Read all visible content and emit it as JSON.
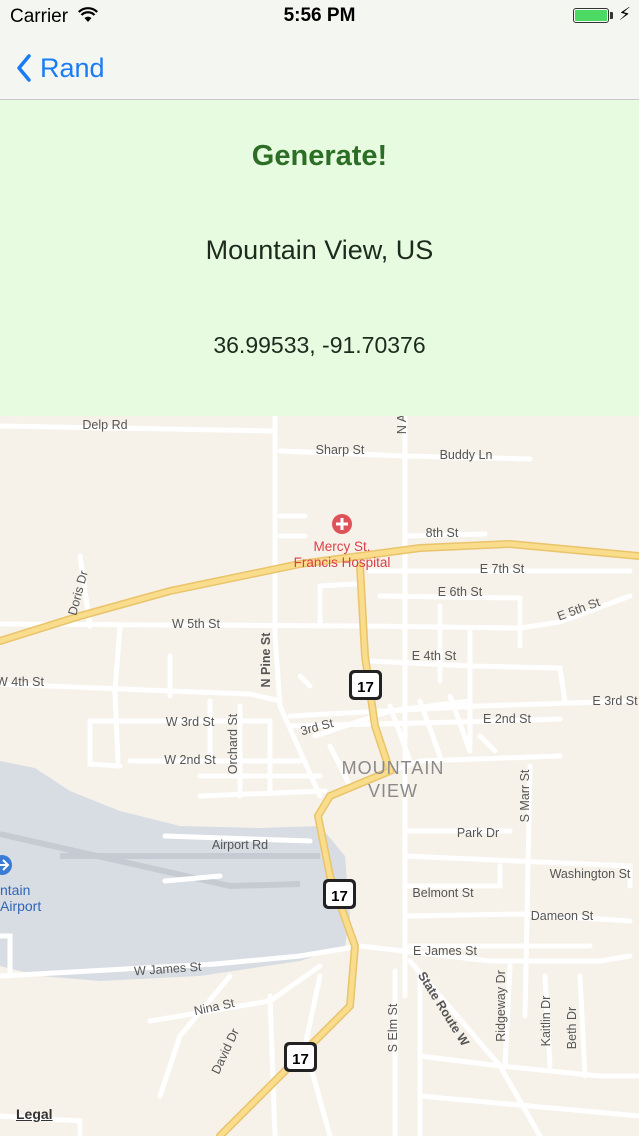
{
  "status_bar": {
    "carrier": "Carrier",
    "time": "5:56 PM"
  },
  "nav": {
    "back_label": "Rand"
  },
  "panel": {
    "generate_label": "Generate!",
    "place": "Mountain View, US",
    "coordinates": "36.99533, -91.70376"
  },
  "map": {
    "city_label_line1": "Mountain",
    "city_label_line2": "View",
    "hospital_line1": "Mercy St.",
    "hospital_line2": "Francis Hospital",
    "airport_line1": "ntain",
    "airport_line2": "Airport",
    "route_number": "17",
    "legal": "Legal",
    "streets": {
      "delp": "Delp Rd",
      "sharp": "Sharp St",
      "buddy": "Buddy Ln",
      "eighth": "8th St",
      "e7": "E 7th St",
      "e6": "E 6th St",
      "e5": "E 5th St",
      "w5": "W 5th St",
      "doris": "Doris Dr",
      "npine": "N Pine St",
      "e4": "E 4th St",
      "w4": "W 4th St",
      "e3": "E 3rd St",
      "w3": "W 3rd St",
      "third": "3rd St",
      "e2": "E 2nd St",
      "w2": "W 2nd St",
      "orchard": "Orchard St",
      "smarr": "S Marr St",
      "park": "Park Dr",
      "airport_rd": "Airport Rd",
      "washington": "Washington St",
      "belmont": "Belmont St",
      "dameon": "Dameon St",
      "ejames": "E James St",
      "wjames": "W James St",
      "nina": "Nina St",
      "david": "David Dr",
      "selm": "S Elm St",
      "state_route": "State Route W",
      "ridgeway": "Ridgeway Dr",
      "kaitlin": "Kaitlin Dr",
      "beth": "Beth Dr",
      "na": "N A"
    }
  },
  "colors": {
    "accent": "#1a7cf5",
    "panel_bg": "#e6fbdf",
    "generate_text": "#2c6e25",
    "map_bg": "#f6f2ea",
    "major_road": "#f6d37a",
    "water": "#d8dde4"
  }
}
